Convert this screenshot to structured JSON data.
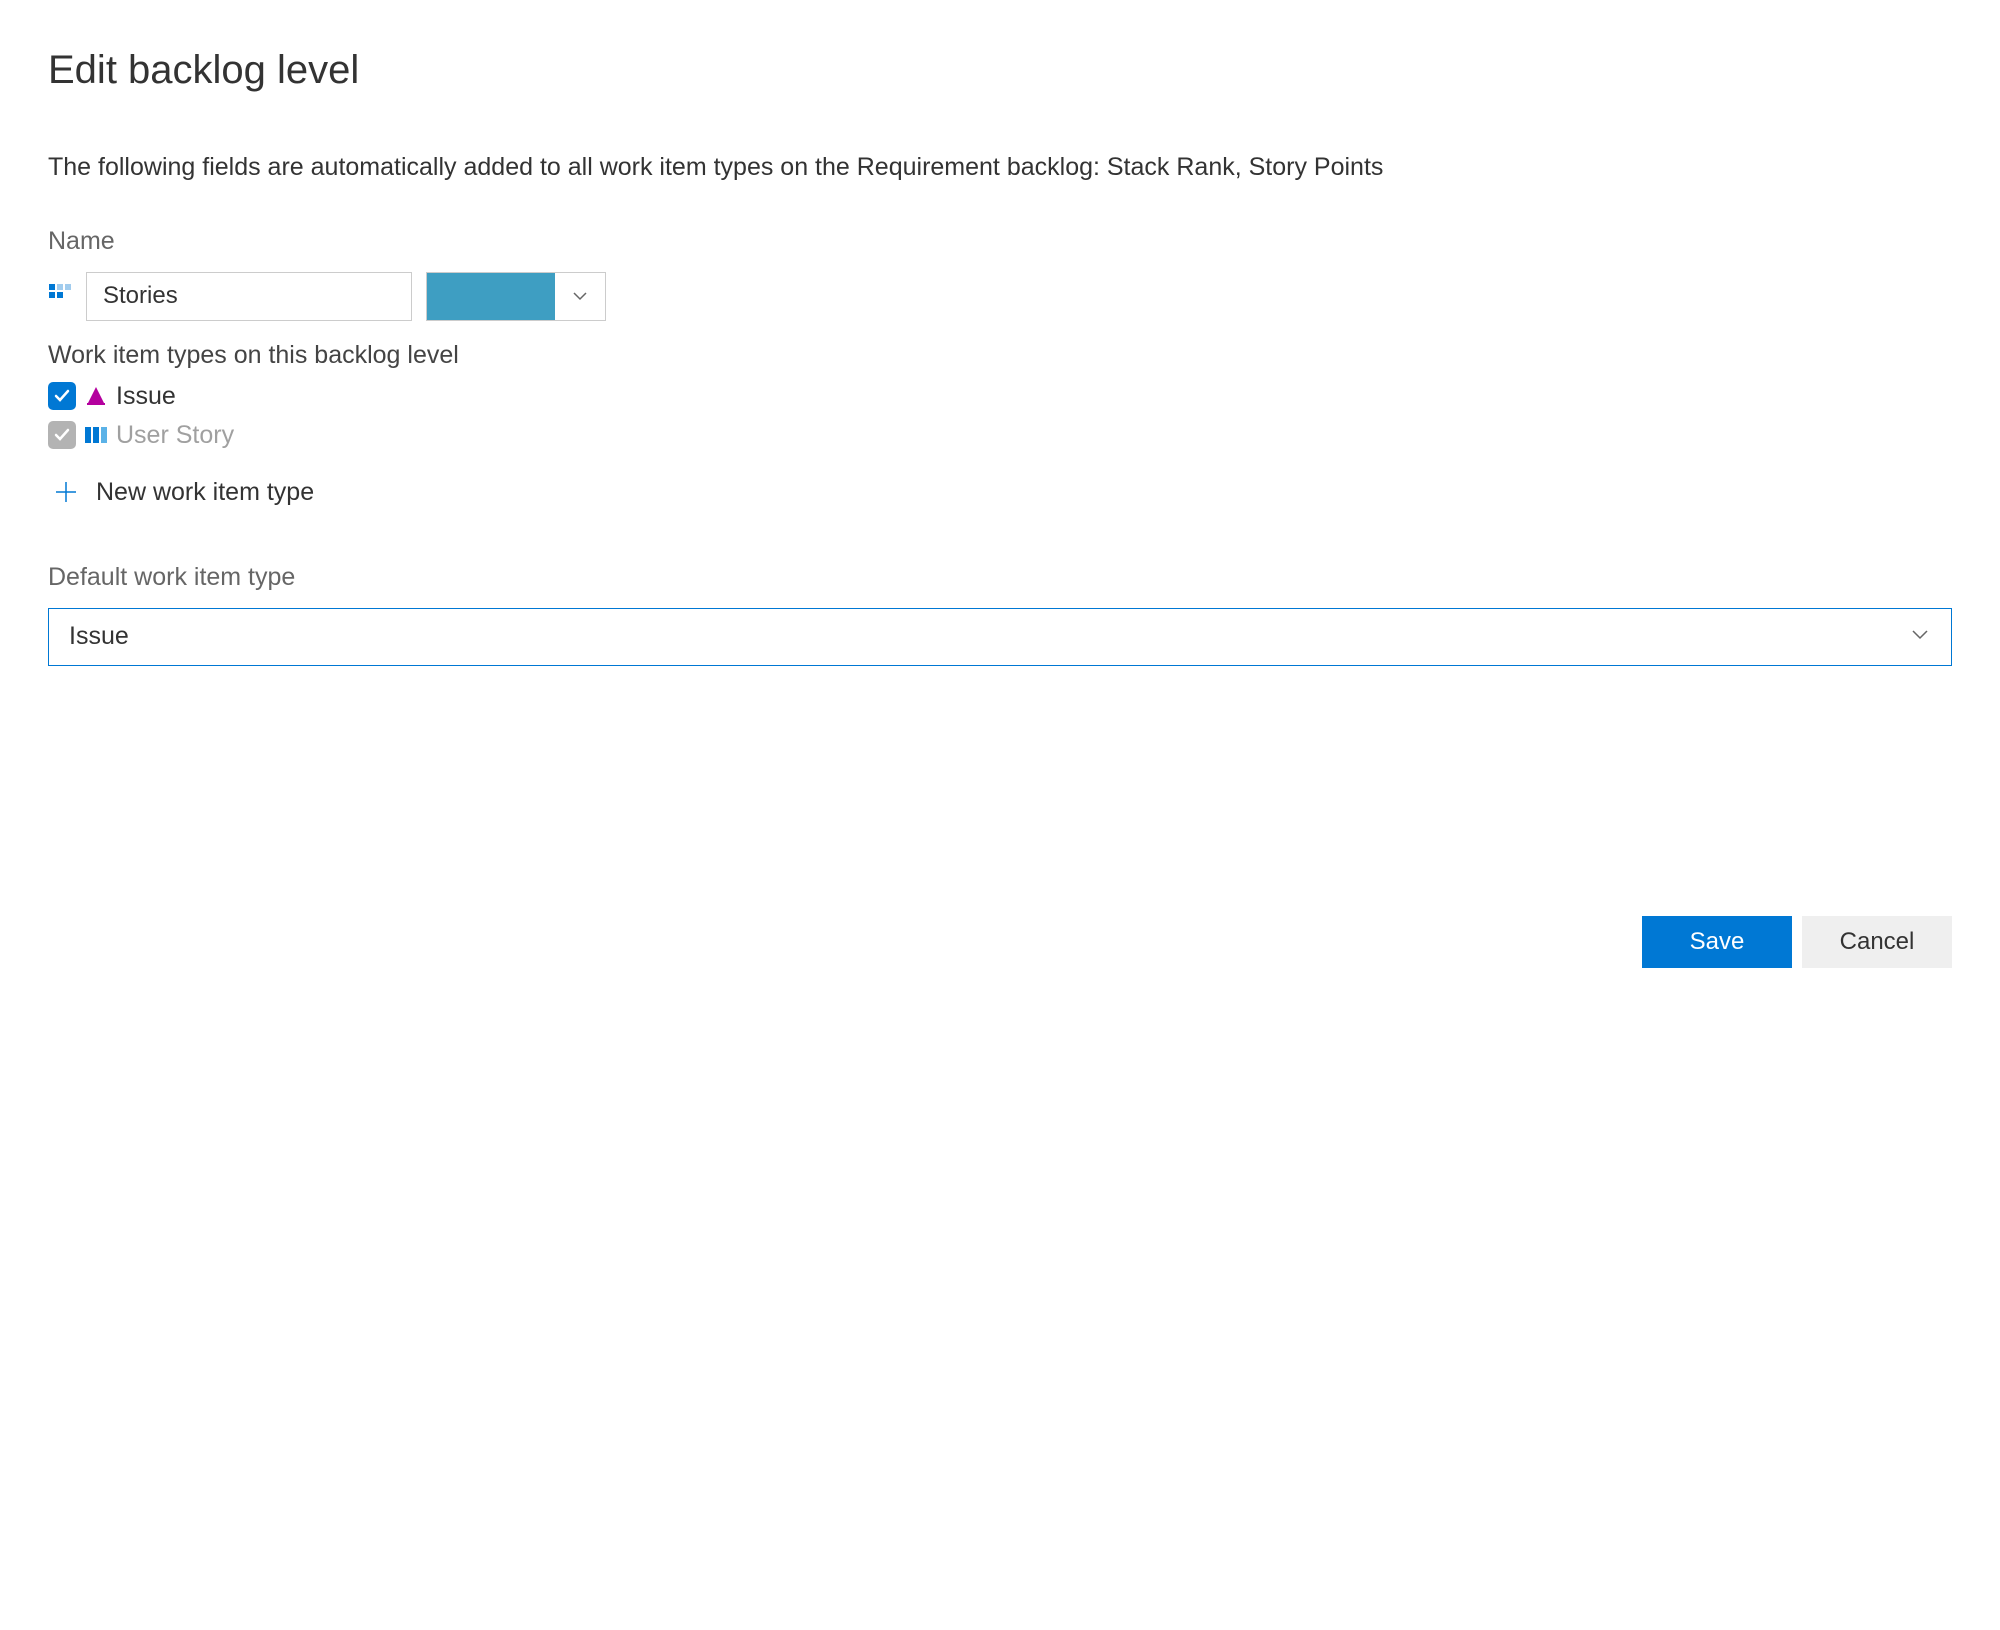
{
  "dialog": {
    "title": "Edit backlog level",
    "description": "The following fields are automatically added to all work item types on the Requirement backlog: Stack Rank, Story Points"
  },
  "name": {
    "label": "Name",
    "value": "Stories",
    "color": "#3e9ec2"
  },
  "work_item_types": {
    "label": "Work item types on this backlog level",
    "items": [
      {
        "label": "Issue",
        "checked": true,
        "disabled": false,
        "icon_color": "#b4009e"
      },
      {
        "label": "User Story",
        "checked": true,
        "disabled": true,
        "icon_color": "#0078d4"
      }
    ],
    "new_label": "New work item type"
  },
  "default_wit": {
    "label": "Default work item type",
    "value": "Issue"
  },
  "buttons": {
    "save": "Save",
    "cancel": "Cancel"
  }
}
